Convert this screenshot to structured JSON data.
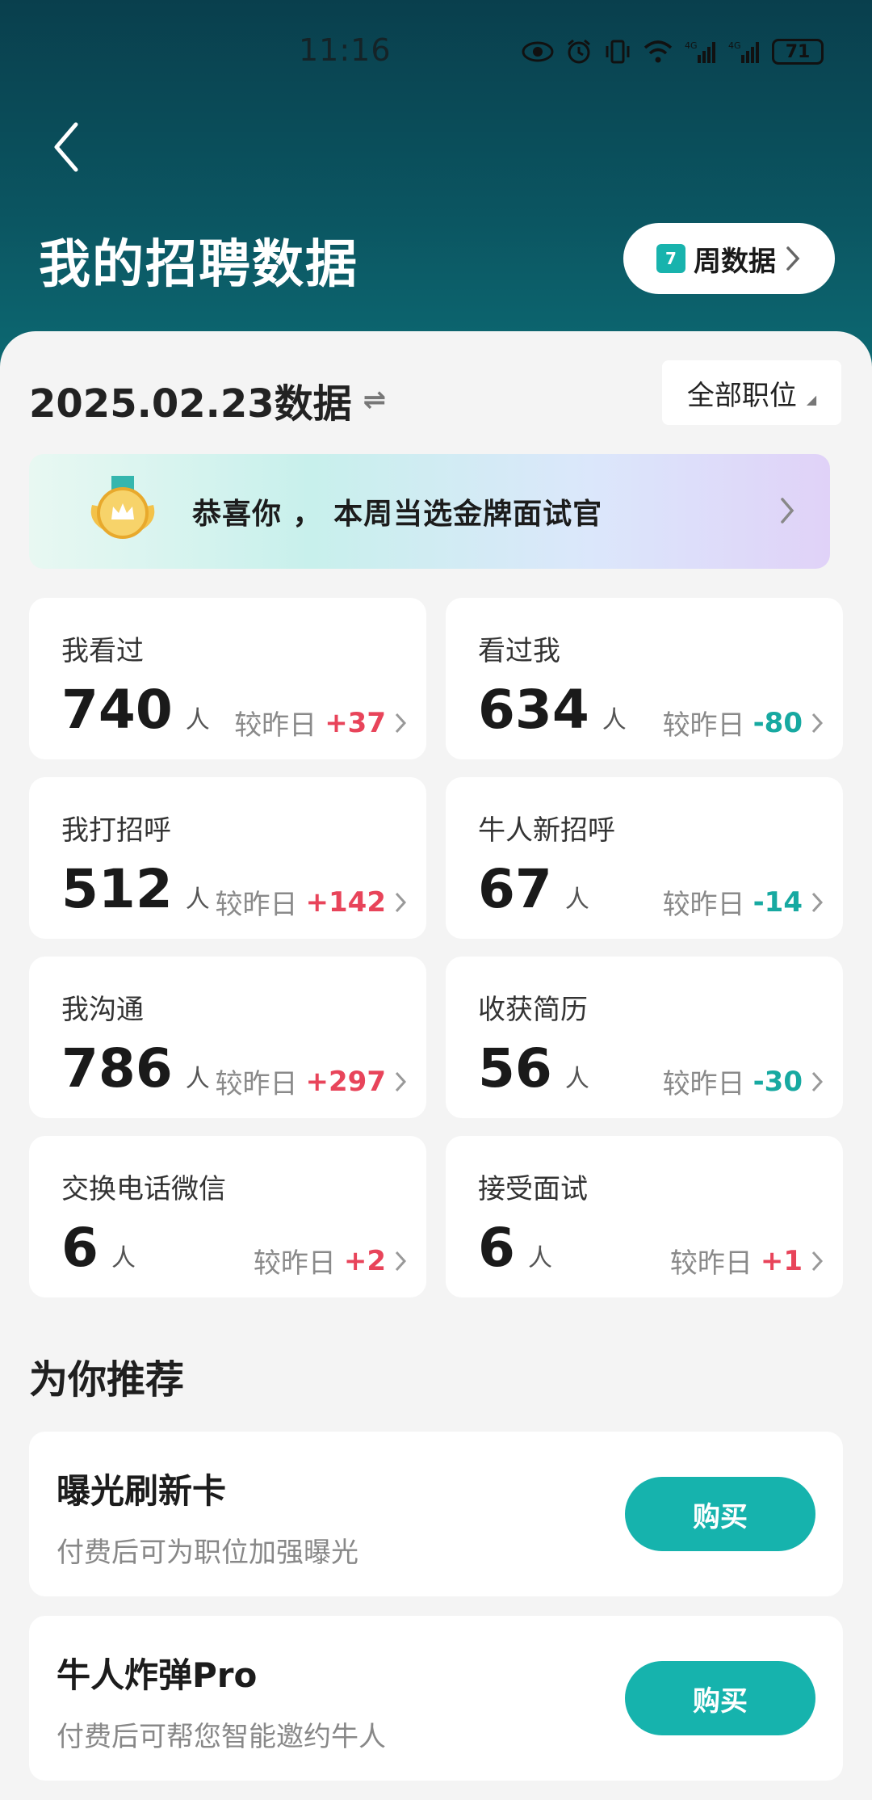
{
  "status": {
    "time": "11:16",
    "battery": "71"
  },
  "header": {
    "title": "我的招聘数据",
    "week_button": "周数据",
    "calendar_day": "7"
  },
  "date_title": "2025.02.23数据",
  "job_filter": "全部职位",
  "banner": {
    "text": "恭喜你 ， 本周当选金牌面试官"
  },
  "compare_label": "较昨日",
  "unit": "人",
  "stats": [
    {
      "label": "我看过",
      "value": "740",
      "delta": "+37",
      "trend": "up"
    },
    {
      "label": "看过我",
      "value": "634",
      "delta": "-80",
      "trend": "down"
    },
    {
      "label": "我打招呼",
      "value": "512",
      "delta": "+142",
      "trend": "up"
    },
    {
      "label": "牛人新招呼",
      "value": "67",
      "delta": "-14",
      "trend": "down"
    },
    {
      "label": "我沟通",
      "value": "786",
      "delta": "+297",
      "trend": "up"
    },
    {
      "label": "收获简历",
      "value": "56",
      "delta": "-30",
      "trend": "down"
    },
    {
      "label": "交换电话微信",
      "value": "6",
      "delta": "+2",
      "trend": "up"
    },
    {
      "label": "接受面试",
      "value": "6",
      "delta": "+1",
      "trend": "up"
    }
  ],
  "recommend": {
    "title": "为你推荐",
    "items": [
      {
        "title": "曝光刷新卡",
        "desc": "付费后可为职位加强曝光",
        "button": "购买"
      },
      {
        "title": "牛人炸弹Pro",
        "desc": "付费后可帮您智能邀约牛人",
        "button": "购买"
      }
    ]
  },
  "colors": {
    "accent": "#16b3ad",
    "positive": "#e8445a",
    "negative": "#17a9a1",
    "header_dark": "#093f4d"
  }
}
